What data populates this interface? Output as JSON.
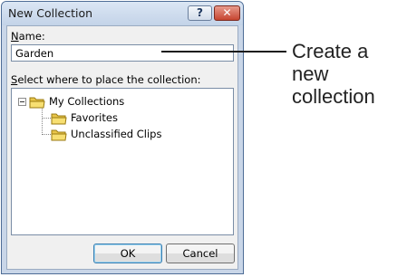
{
  "dialog": {
    "title": "New Collection",
    "help_label": "?",
    "close_label": "✕"
  },
  "form": {
    "name_label_accel": "N",
    "name_label_rest": "ame:",
    "name_value": "Garden",
    "select_label_accel": "S",
    "select_label_rest": "elect where to place the collection:"
  },
  "tree": {
    "items": [
      {
        "label": "My Collections",
        "icon": "folder-icon"
      },
      {
        "label": "Favorites",
        "icon": "folder-icon"
      },
      {
        "label": "Unclassified Clips",
        "icon": "folder-icon"
      }
    ]
  },
  "buttons": {
    "ok_label": "OK",
    "cancel_label": "Cancel"
  },
  "callout": {
    "text": "Create a new collection"
  }
}
